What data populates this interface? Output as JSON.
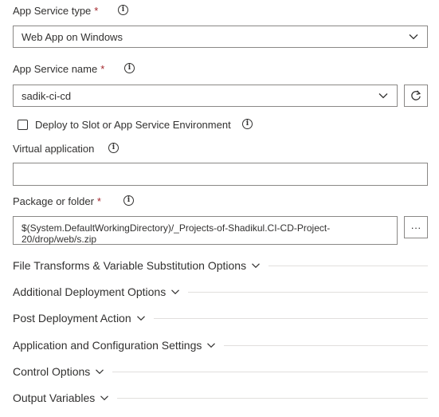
{
  "app_service_type": {
    "label": "App Service type",
    "required": "*",
    "value": "Web App on Windows"
  },
  "app_service_name": {
    "label": "App Service name",
    "required": "*",
    "value": "sadik-ci-cd"
  },
  "deploy_slot": {
    "label": "Deploy to Slot or App Service Environment",
    "checked": false
  },
  "virtual_application": {
    "label": "Virtual application",
    "value": ""
  },
  "package_folder": {
    "label": "Package or folder",
    "required": "*",
    "value_line1": "$(System.DefaultWorkingDirectory)/_Projects-of-Shadikul.CI-CD-Project-",
    "value_line2": "20/drop/web/s.zip",
    "browse_label": "···"
  },
  "sections": [
    {
      "title": "File Transforms & Variable Substitution Options"
    },
    {
      "title": "Additional Deployment Options"
    },
    {
      "title": "Post Deployment Action"
    },
    {
      "title": "Application and Configuration Settings"
    },
    {
      "title": "Control Options"
    },
    {
      "title": "Output Variables"
    }
  ],
  "icons": {
    "info": "i",
    "refresh": "refresh-icon",
    "chevron": "chevron-down-icon"
  }
}
